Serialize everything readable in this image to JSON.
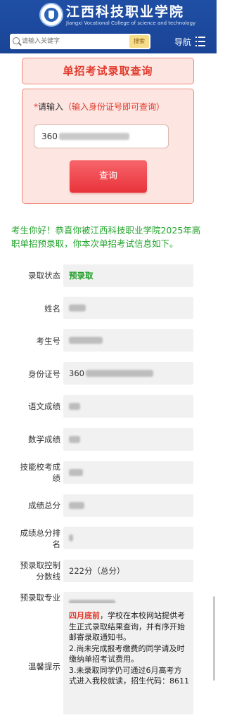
{
  "header": {
    "title_cn": "江西科技职业学院",
    "title_en": "Jiangxi Vocational College of science and technology",
    "search_placeholder": "请输入关键字",
    "search_button": "搜索",
    "nav_label": "导航"
  },
  "query": {
    "panel_title": "单招考试录取查询",
    "prompt_star": "*",
    "prompt_text": "请输入",
    "prompt_hint": "（输入身份证号即可查询）",
    "id_value_prefix": "360",
    "button_label": "查询"
  },
  "welcome_message": "考生你好！恭喜你被江西科技职业学院2025年高职单招预录取，你本次单招考试信息如下。",
  "results": {
    "status_label": "录取状态",
    "status_value": "预录取",
    "name_label": "姓名",
    "exam_no_label": "考生号",
    "id_label": "身份证号",
    "id_value_prefix": "360",
    "chinese_label": "语文成绩",
    "math_label": "数学成绩",
    "skill_label": "技能校考成绩",
    "total_label": "成绩总分",
    "rank_label": "成绩总分排名",
    "cutoff_label": "预录取控制分数线",
    "cutoff_value": "222分（总分）",
    "major_label": "预录取专业",
    "notice_label": "温馨提示",
    "notice_highlight": "四月底前",
    "notice_line1": "，学校在本校网站提供考生正式录取结果查询，并有序开始邮寄录取通知书。",
    "notice_line2": "2.尚未完成报考缴费的同学请及时缴纳单招考试费用。",
    "notice_line3": "3.未录取同学仍可通过6月高考方式进入我校就读，招生代码：8611"
  },
  "colors": {
    "header_blue": "#1f4fa5",
    "accent_red": "#e23a2c",
    "success_green": "#22a32b",
    "panel_pink": "#fde5e1"
  }
}
